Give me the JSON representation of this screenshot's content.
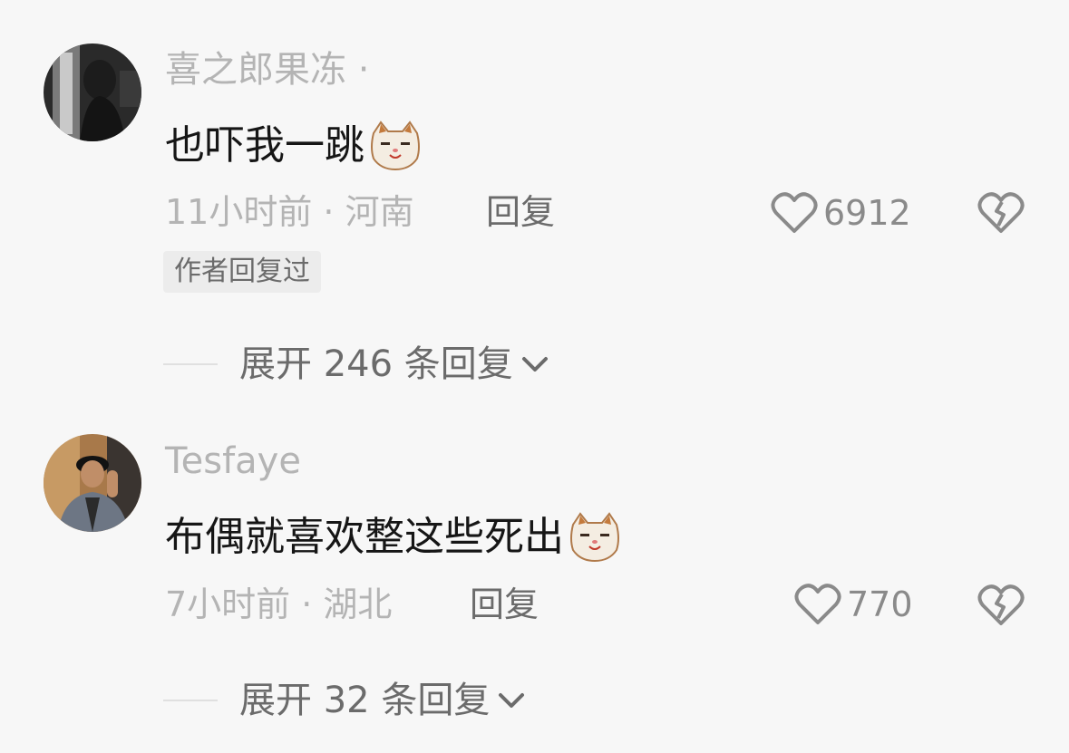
{
  "comments": [
    {
      "username": "喜之郎果冻 ·",
      "text": "也吓我一跳",
      "emoji": "cat-face-emoji",
      "meta": "11小时前 · 河南",
      "reply_label": "回复",
      "likes": "6912",
      "badge": "作者回复过",
      "expand_label": "展开 246 条回复"
    },
    {
      "username": "Tesfaye",
      "text": "布偶就喜欢整这些死出",
      "emoji": "cat-face-emoji",
      "meta": "7小时前 · 湖北",
      "reply_label": "回复",
      "likes": "770",
      "expand_label": "展开 32 条回复"
    }
  ],
  "colors": {
    "background": "#f7f7f7",
    "primary_text": "#161616",
    "secondary_text": "#b4b4b4",
    "action_text": "#6b6b6b"
  }
}
